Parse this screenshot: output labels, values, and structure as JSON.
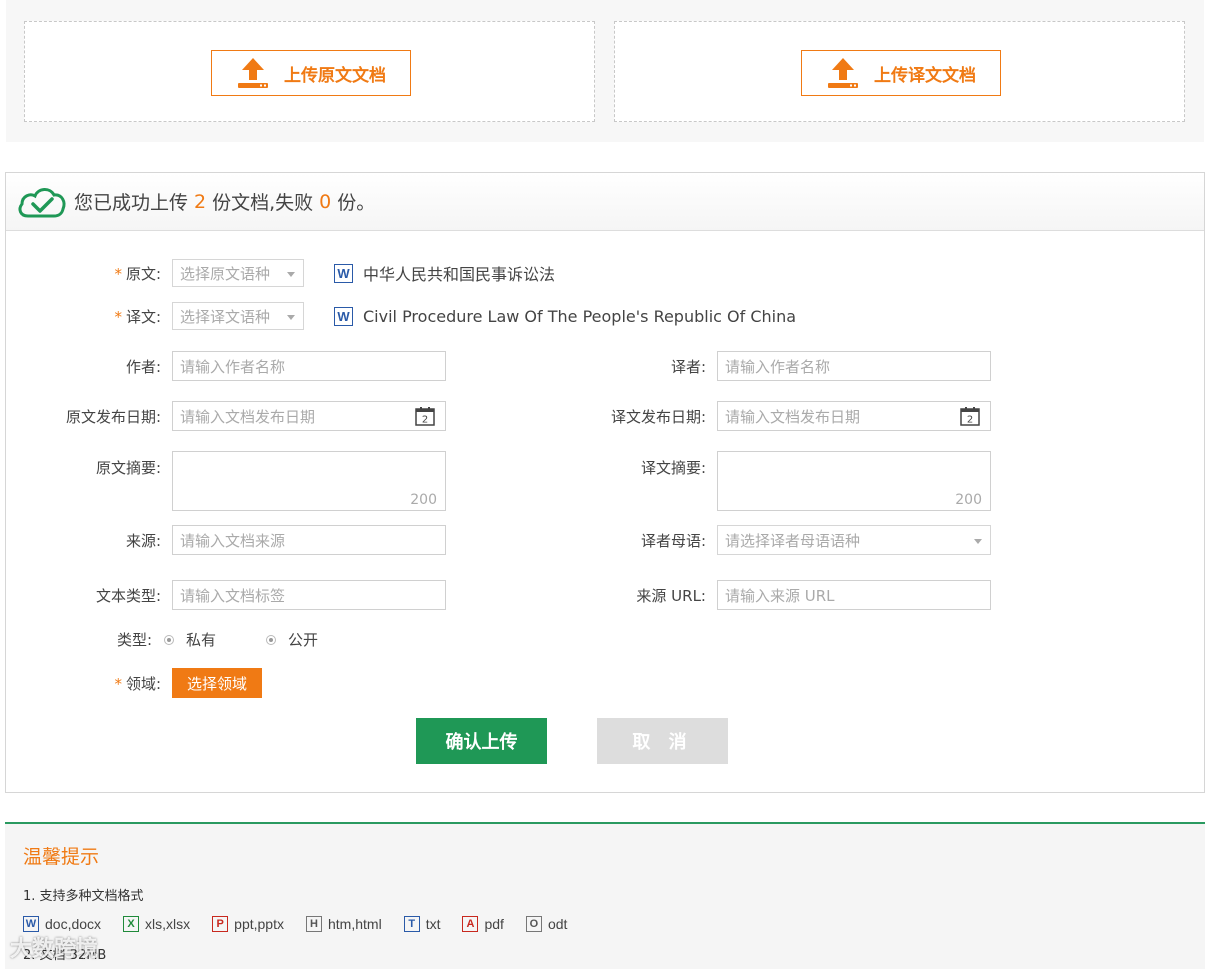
{
  "upload": {
    "source_label": "上传原文文档",
    "target_label": "上传译文文档"
  },
  "result": {
    "prefix": "您已成功上传",
    "success_count": "2",
    "middle": "份文档,失败",
    "fail_count": "0",
    "suffix": "份。"
  },
  "form": {
    "source_lang_label": "原文:",
    "source_lang_placeholder": "选择原文语种",
    "source_file": "中华人民共和国民事诉讼法",
    "target_lang_label": "译文:",
    "target_lang_placeholder": "选择译文语种",
    "target_file": "Civil Procedure Law Of The People's Republic Of China",
    "author_label": "作者:",
    "author_placeholder": "请输入作者名称",
    "translator_label": "译者:",
    "translator_placeholder": "请输入作者名称",
    "source_date_label": "原文发布日期:",
    "source_date_placeholder": "请输入文档发布日期",
    "target_date_label": "译文发布日期:",
    "target_date_placeholder": "请输入文档发布日期",
    "calendar_day": "2",
    "source_abstract_label": "原文摘要:",
    "target_abstract_label": "译文摘要:",
    "abstract_limit": "200",
    "origin_label": "来源:",
    "origin_placeholder": "请输入文档来源",
    "translator_lang_label": "译者母语:",
    "translator_lang_placeholder": "请选择译者母语语种",
    "text_type_label": "文本类型:",
    "text_type_placeholder": "请输入文档标签",
    "source_url_label": "来源 URL:",
    "source_url_placeholder": "请输入来源 URL",
    "type_label": "类型:",
    "type_private": "私有",
    "type_public": "公开",
    "domain_label": "领域:",
    "domain_button": "选择领域",
    "required_mark": "*",
    "confirm_button": "确认上传",
    "cancel_button": "取 消"
  },
  "tips": {
    "title": "温馨提示",
    "line1": "1. 支持多种文档格式",
    "formats": [
      {
        "icon": "W",
        "label": "doc,docx",
        "color": "#2a5aa8"
      },
      {
        "icon": "X",
        "label": "xls,xlsx",
        "color": "#1f8a3a"
      },
      {
        "icon": "P",
        "label": "ppt,pptx",
        "color": "#c8281e"
      },
      {
        "icon": "H",
        "label": "htm,html",
        "color": "#555555"
      },
      {
        "icon": "T",
        "label": "txt",
        "color": "#2a5aa8"
      },
      {
        "icon": "A",
        "label": "pdf",
        "color": "#c8281e"
      },
      {
        "icon": "O",
        "label": "odt",
        "color": "#555555"
      }
    ],
    "line2": "2. 文档 32MB"
  },
  "watermark": "大数跨境",
  "colors": {
    "accent": "#f07a14",
    "primary": "#1f9856"
  }
}
